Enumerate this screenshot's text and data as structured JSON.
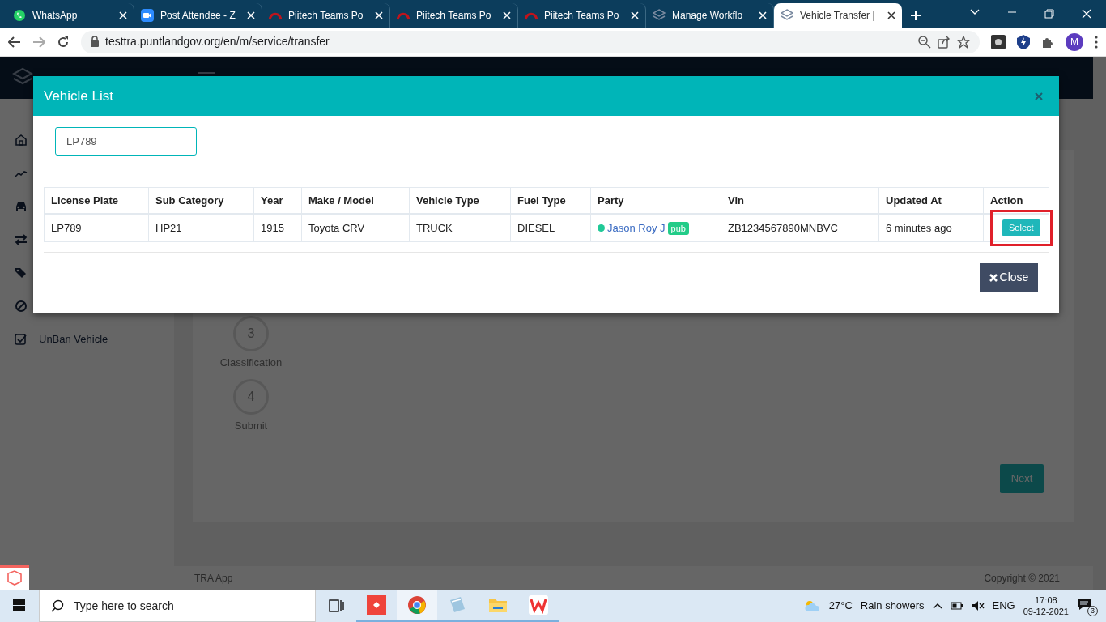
{
  "browser": {
    "tabs": [
      {
        "kind": "whatsapp",
        "title": "WhatsApp",
        "selected": false
      },
      {
        "kind": "zoom",
        "title": "Post Attendee - Z",
        "selected": false
      },
      {
        "kind": "arc",
        "title": "Piitech Teams Po",
        "selected": false
      },
      {
        "kind": "arc",
        "title": "Piitech Teams Po",
        "selected": false
      },
      {
        "kind": "arc",
        "title": "Piitech Teams Po",
        "selected": false
      },
      {
        "kind": "layers",
        "title": "Manage Workflo",
        "selected": false
      },
      {
        "kind": "layers",
        "title": "Vehicle Transfer |",
        "selected": true
      }
    ],
    "url": "testtra.puntlandgov.org/en/m/service/transfer",
    "profile": "M"
  },
  "app": {
    "sidebar": [
      {
        "kind": "home"
      },
      {
        "kind": "chart"
      },
      {
        "kind": "car"
      },
      {
        "kind": "transfer"
      },
      {
        "kind": "tags"
      },
      {
        "kind": "ban"
      },
      {
        "kind": "check",
        "label": "UnBan Vehicle"
      }
    ],
    "steps": [
      {
        "number": "3",
        "label": "Classification"
      },
      {
        "number": "4",
        "label": "Submit"
      }
    ],
    "next_button": "Next",
    "footer": {
      "left": "TRA App",
      "right": "Copyright © 2021"
    }
  },
  "modal": {
    "title": "Vehicle List",
    "search": {
      "value": "LP789"
    },
    "table": {
      "columns": [
        "License Plate",
        "Sub Category",
        "Year",
        "Make / Model",
        "Vehicle Type",
        "Fuel Type",
        "Party",
        "Vin",
        "Updated At",
        "Action"
      ],
      "rows": [
        {
          "cells": [
            {
              "kind": "text",
              "text": "LP789"
            },
            {
              "kind": "text",
              "text": "HP21"
            },
            {
              "kind": "text",
              "text": "1915"
            },
            {
              "kind": "text",
              "text": "Toyota CRV"
            },
            {
              "kind": "text",
              "text": "TRUCK"
            },
            {
              "kind": "text",
              "text": "DIESEL"
            },
            {
              "kind": "party",
              "text": "Jason Roy J",
              "color": "#20c997",
              "badge": "pub"
            },
            {
              "kind": "text",
              "text": "ZB1234567890MNBVC"
            },
            {
              "kind": "text",
              "text": "6 minutes ago"
            },
            {
              "kind": "button",
              "text": "Select",
              "highlighted": true
            }
          ]
        }
      ]
    },
    "close_button": "Close"
  },
  "taskbar": {
    "search_placeholder": "Type here to search",
    "apps": [
      {
        "kind": "anydesk",
        "selected": false
      },
      {
        "kind": "chrome",
        "selected": true
      },
      {
        "kind": "notepad",
        "selected": false
      },
      {
        "kind": "folder",
        "selected": false
      },
      {
        "kind": "wps",
        "selected": false
      }
    ],
    "temperature": "27°C",
    "weather": "Rain showers",
    "language": "ENG",
    "time": "17:08",
    "date": "09-12-2021",
    "notifications": "3"
  }
}
